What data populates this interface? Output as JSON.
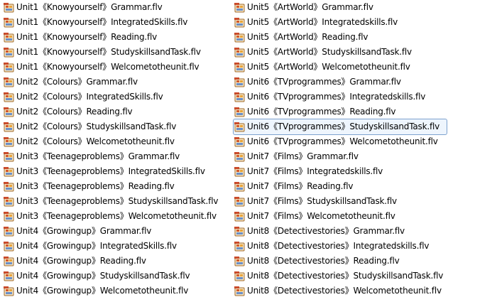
{
  "explorer": {
    "icon": "video-file-icon",
    "colors": {
      "background": "#ffffff",
      "selection_border": "#7da2ce",
      "selection_fill": "#eef5fd"
    },
    "left_column": [
      "Unit1《Knowyourself》Grammar.flv",
      "Unit1《Knowyourself》IntegratedSkills.flv",
      "Unit1《Knowyourself》Reading.flv",
      "Unit1《Knowyourself》StudyskillsandTask.flv",
      "Unit1《Knowyourself》Welcometotheunit.flv",
      "Unit2《Colours》Grammar.flv",
      "Unit2《Colours》IntegratedSkills.flv",
      "Unit2《Colours》Reading.flv",
      "Unit2《Colours》StudyskillsandTask.flv",
      "Unit2《Colours》Welcometotheunit.flv",
      "Unit3《Teenageproblems》Grammar.flv",
      "Unit3《Teenageproblems》IntegratedSkills.flv",
      "Unit3《Teenageproblems》Reading.flv",
      "Unit3《Teenageproblems》StudyskillsandTask.flv",
      "Unit3《Teenageproblems》Welcometotheunit.flv",
      "Unit4《Growingup》Grammar.flv",
      "Unit4《Growingup》IntegratedSkills.flv",
      "Unit4《Growingup》Reading.flv",
      "Unit4《Growingup》StudyskillsandTask.flv",
      "Unit4《Growingup》Welcometotheunit.flv"
    ],
    "right_column": [
      "Unit5《ArtWorld》Grammar.flv",
      "Unit5《ArtWorld》Integratedskills.flv",
      "Unit5《ArtWorld》Reading.flv",
      "Unit5《ArtWorld》StudyskillsandTask.flv",
      "Unit5《ArtWorld》Welcometotheunit.flv",
      "Unit6《TVprogrammes》Grammar.flv",
      "Unit6《TVprogrammes》Integratedskills.flv",
      "Unit6《TVprogrammes》Reading.flv",
      "Unit6《TVprogrammes》StudyskillsandTask.flv",
      "Unit6《TVprogrammes》Welcometotheunit.flv",
      "Unit7《Films》Grammar.flv",
      "Unit7《Films》Integratedskills.flv",
      "Unit7《Films》Reading.flv",
      "Unit7《Films》StudyskillsandTask.flv",
      "Unit7《Films》Welcometotheunit.flv",
      "Unit8《Detectivestories》Grammar.flv",
      "Unit8《Detectivestories》Integratedskills.flv",
      "Unit8《Detectivestories》Reading.flv",
      "Unit8《Detectivestories》StudyskillsandTask.flv",
      "Unit8《Detectivestories》Welcometotheunit.flv"
    ],
    "selected": "Unit6《TVprogrammes》StudyskillsandTask.flv"
  }
}
